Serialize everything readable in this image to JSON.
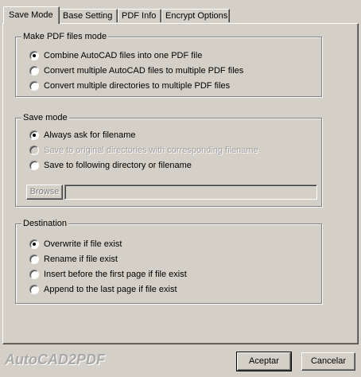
{
  "tabs": [
    {
      "label": "Save Mode",
      "active": true
    },
    {
      "label": "Base Setting",
      "active": false
    },
    {
      "label": "PDF Info",
      "active": false
    },
    {
      "label": "Encrypt Options",
      "active": false
    }
  ],
  "make_pdf_mode": {
    "title": "Make PDF files mode",
    "options": [
      {
        "label": "Combine AutoCAD files into one PDF file",
        "checked": true,
        "disabled": false
      },
      {
        "label": "Convert multiple AutoCAD files to multiple PDF files",
        "checked": false,
        "disabled": false
      },
      {
        "label": "Convert multiple directories to multiple PDF files",
        "checked": false,
        "disabled": false
      }
    ]
  },
  "save_mode": {
    "title": "Save mode",
    "options": [
      {
        "label": "Always ask for filename",
        "checked": true,
        "disabled": false
      },
      {
        "label": "Save to original directories with corresponding filename",
        "checked": false,
        "disabled": true
      },
      {
        "label": "Save to following directory or filename",
        "checked": false,
        "disabled": false
      }
    ],
    "browse_label": "Browse",
    "path_value": ""
  },
  "destination": {
    "title": "Destination",
    "options": [
      {
        "label": "Overwrite if file exist",
        "checked": true,
        "disabled": false
      },
      {
        "label": "Rename if file exist",
        "checked": false,
        "disabled": false
      },
      {
        "label": "Insert before the first page if file exist",
        "checked": false,
        "disabled": false
      },
      {
        "label": "Append to the last page if file exist",
        "checked": false,
        "disabled": false
      }
    ]
  },
  "footer": {
    "brand": "AutoCAD2PDF",
    "ok_label": "Aceptar",
    "cancel_label": "Cancelar"
  },
  "colors": {
    "face": "#d4d0c8",
    "brand_text": "#a9a9a9",
    "disabled_text": "#a0a0a0"
  }
}
